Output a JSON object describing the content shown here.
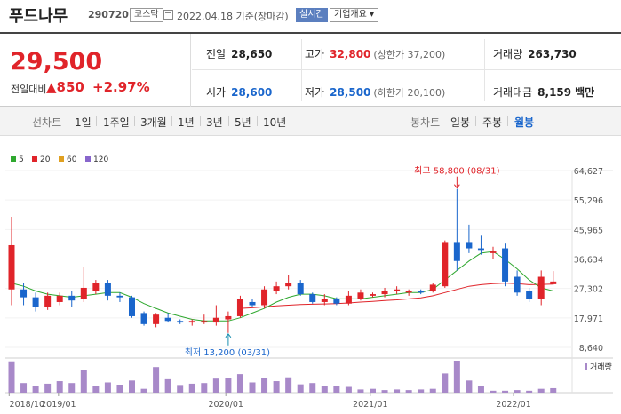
{
  "header": {
    "name": "푸드나무",
    "code": "290720",
    "market": "코스닥",
    "as_of": "2022.04.18  기준(장마감)",
    "realtime_label": "실시간",
    "company_label": "기업개요"
  },
  "summary": {
    "price": "29,500",
    "change_label": "전일대비",
    "change_value": "850",
    "change_pct": "+2.97%",
    "prev_close_label": "전일",
    "prev_close": "28,650",
    "high_label": "고가",
    "high": "32,800",
    "upper_limit": "(상한가 37,200)",
    "volume_label": "거래량",
    "volume": "263,730",
    "open_label": "시가",
    "open": "28,600",
    "low_label": "저가",
    "low": "28,500",
    "lower_limit": "(하한가 20,100)",
    "amount_label": "거래대금",
    "amount": "8,159",
    "amount_unit": "백만"
  },
  "tabs": {
    "line_chart": "선차트",
    "day1": "1일",
    "week1": "1주일",
    "month3": "3개월",
    "year1": "1년",
    "year3": "3년",
    "year5": "5년",
    "year10": "10년",
    "candle_chart": "봉차트",
    "daily": "일봉",
    "weekly": "주봉",
    "monthly": "월봉",
    "active": "월봉"
  },
  "legend": [
    {
      "label": "5",
      "color": "#2fa82f"
    },
    {
      "label": "20",
      "color": "#e0242a"
    },
    {
      "label": "60",
      "color": "#e0a020"
    },
    {
      "label": "120",
      "color": "#8866cc"
    }
  ],
  "colors": {
    "up": "#e0242a",
    "down": "#1a66cc",
    "ma5": "#2fa82f",
    "ma20": "#e0242a",
    "volume": "#a889c9"
  },
  "chart_data": {
    "type": "candlestick",
    "interval": "monthly",
    "y_ticks": [
      "64,627",
      "55,296",
      "45,965",
      "36,634",
      "27,302",
      "17,971",
      "8,640"
    ],
    "ylim": [
      8640,
      64627
    ],
    "x_labels": [
      "2018/10",
      "2019/01",
      "2020/01",
      "2021/01",
      "2022/01"
    ],
    "annotations": {
      "high_text": "최고 58,800 (08/31)",
      "low_text": "최저 13,200 (03/31)"
    },
    "volume_label": "거래량",
    "candles": [
      {
        "o": 27000,
        "c": 41000,
        "h": 50000,
        "l": 22000
      },
      {
        "o": 27000,
        "c": 24500,
        "h": 29000,
        "l": 22000
      },
      {
        "o": 24500,
        "c": 21500,
        "h": 26000,
        "l": 20000
      },
      {
        "o": 21500,
        "c": 25000,
        "h": 26000,
        "l": 20500
      },
      {
        "o": 23000,
        "c": 25000,
        "h": 26000,
        "l": 22000
      },
      {
        "o": 25000,
        "c": 23500,
        "h": 26500,
        "l": 21500
      },
      {
        "o": 24000,
        "c": 27500,
        "h": 34000,
        "l": 23000
      },
      {
        "o": 26500,
        "c": 29000,
        "h": 30000,
        "l": 25500
      },
      {
        "o": 29000,
        "c": 25000,
        "h": 30000,
        "l": 23500
      },
      {
        "o": 25000,
        "c": 24500,
        "h": 26000,
        "l": 23000
      },
      {
        "o": 24500,
        "c": 18500,
        "h": 25000,
        "l": 18000
      },
      {
        "o": 19500,
        "c": 16000,
        "h": 20000,
        "l": 15500
      },
      {
        "o": 16000,
        "c": 19000,
        "h": 19500,
        "l": 15000
      },
      {
        "o": 18000,
        "c": 17000,
        "h": 19500,
        "l": 16500
      },
      {
        "o": 17000,
        "c": 16500,
        "h": 17500,
        "l": 16000
      },
      {
        "o": 16500,
        "c": 17000,
        "h": 17500,
        "l": 15500
      },
      {
        "o": 16500,
        "c": 17000,
        "h": 19000,
        "l": 16000
      },
      {
        "o": 16500,
        "c": 18000,
        "h": 22000,
        "l": 15500
      },
      {
        "o": 17500,
        "c": 18500,
        "h": 20000,
        "l": 13200
      },
      {
        "o": 18500,
        "c": 24000,
        "h": 25000,
        "l": 18000
      },
      {
        "o": 23000,
        "c": 22000,
        "h": 24000,
        "l": 21500
      },
      {
        "o": 22000,
        "c": 27000,
        "h": 28000,
        "l": 21000
      },
      {
        "o": 26500,
        "c": 28000,
        "h": 29500,
        "l": 25500
      },
      {
        "o": 28000,
        "c": 29000,
        "h": 31500,
        "l": 27000
      },
      {
        "o": 29000,
        "c": 25500,
        "h": 30000,
        "l": 25000
      },
      {
        "o": 25500,
        "c": 23000,
        "h": 26000,
        "l": 22500
      },
      {
        "o": 23000,
        "c": 24000,
        "h": 25500,
        "l": 22000
      },
      {
        "o": 24000,
        "c": 22500,
        "h": 24500,
        "l": 22000
      },
      {
        "o": 22500,
        "c": 25000,
        "h": 26500,
        "l": 22000
      },
      {
        "o": 24000,
        "c": 26000,
        "h": 27000,
        "l": 23500
      },
      {
        "o": 25000,
        "c": 25500,
        "h": 26000,
        "l": 24500
      },
      {
        "o": 25500,
        "c": 26500,
        "h": 27500,
        "l": 24500
      },
      {
        "o": 26500,
        "c": 27000,
        "h": 28000,
        "l": 25500
      },
      {
        "o": 26000,
        "c": 26500,
        "h": 27000,
        "l": 25000
      },
      {
        "o": 26500,
        "c": 26000,
        "h": 27000,
        "l": 25500
      },
      {
        "o": 26500,
        "c": 28500,
        "h": 29000,
        "l": 26000
      },
      {
        "o": 28000,
        "c": 42000,
        "h": 42500,
        "l": 27500
      },
      {
        "o": 42000,
        "c": 36000,
        "h": 58800,
        "l": 33000
      },
      {
        "o": 42000,
        "c": 40000,
        "h": 47500,
        "l": 38500
      },
      {
        "o": 40000,
        "c": 39500,
        "h": 44000,
        "l": 38000
      },
      {
        "o": 38500,
        "c": 39000,
        "h": 40500,
        "l": 36500
      },
      {
        "o": 40000,
        "c": 29500,
        "h": 41500,
        "l": 28000
      },
      {
        "o": 31000,
        "c": 26000,
        "h": 33000,
        "l": 25000
      },
      {
        "o": 26500,
        "c": 24000,
        "h": 27500,
        "l": 23000
      },
      {
        "o": 24000,
        "c": 31000,
        "h": 33000,
        "l": 22000
      },
      {
        "o": 28650,
        "c": 29500,
        "h": 32800,
        "l": 28500
      }
    ],
    "ma5": [
      29000,
      28000,
      26500,
      25500,
      25000,
      24500,
      25000,
      25500,
      26000,
      26000,
      24500,
      22500,
      21000,
      19500,
      18500,
      17500,
      17000,
      17000,
      17000,
      18000,
      19500,
      21000,
      23000,
      24500,
      25500,
      25500,
      25000,
      24000,
      24000,
      24000,
      24500,
      25000,
      25500,
      26000,
      26000,
      27000,
      30000,
      33000,
      36000,
      38500,
      39000,
      36500,
      33500,
      30000,
      27500,
      26500
    ],
    "ma20": [
      null,
      null,
      null,
      null,
      null,
      null,
      null,
      null,
      null,
      null,
      null,
      null,
      null,
      null,
      null,
      null,
      null,
      null,
      null,
      21000,
      21200,
      21500,
      21800,
      22000,
      22200,
      22300,
      22400,
      22500,
      22700,
      23000,
      23200,
      23500,
      23700,
      24000,
      24300,
      25000,
      26000,
      27000,
      28000,
      28500,
      28800,
      29000,
      28800,
      28500,
      28600,
      28700
    ],
    "volumes": [
      98,
      30,
      22,
      28,
      36,
      30,
      72,
      20,
      32,
      25,
      38,
      12,
      80,
      42,
      24,
      28,
      30,
      44,
      46,
      58,
      32,
      46,
      36,
      48,
      26,
      30,
      20,
      22,
      18,
      10,
      12,
      8,
      10,
      8,
      10,
      12,
      60,
      100,
      38,
      22,
      6,
      6,
      8,
      6,
      12,
      14
    ]
  }
}
